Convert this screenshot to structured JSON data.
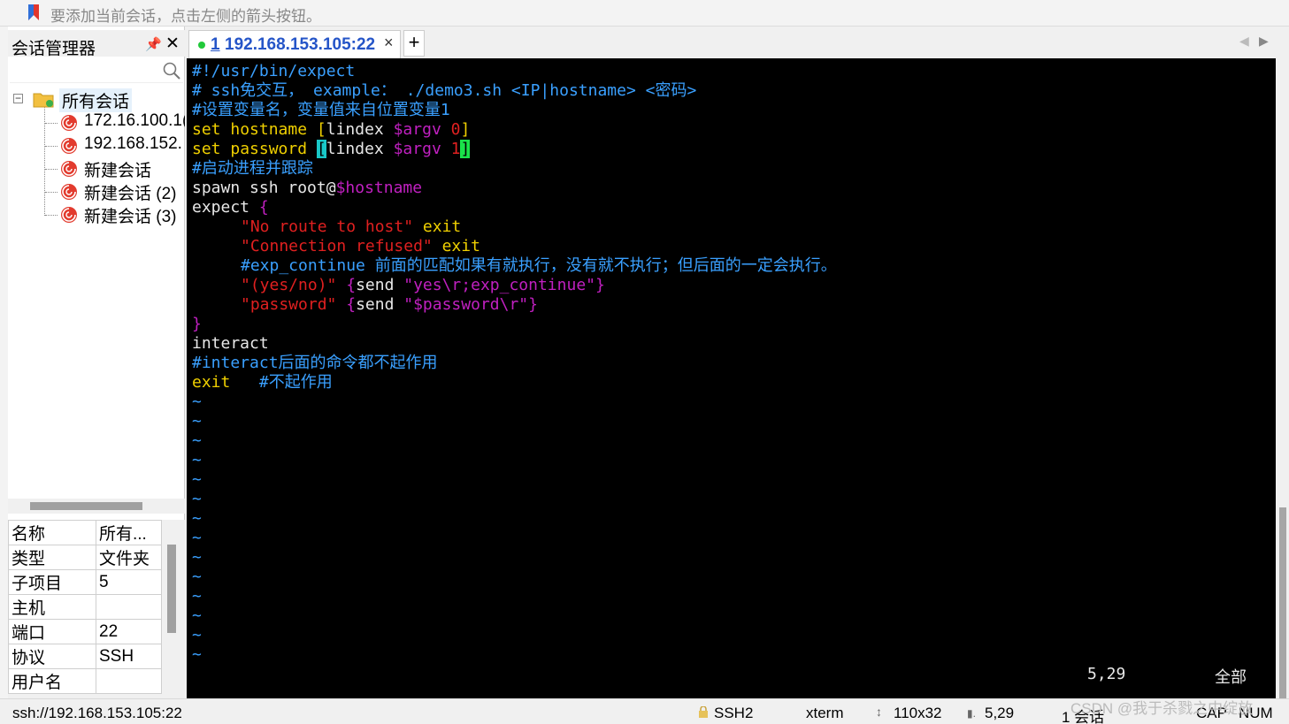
{
  "topbar": {
    "hint": "要添加当前会话，点击左侧的箭头按钮。"
  },
  "session_manager": {
    "title": "会话管理器",
    "pin_glyph": "📌",
    "close_glyph": "✕",
    "tree": {
      "root_label": "所有会话",
      "root_expander": "−",
      "items": [
        {
          "label": "172.16.100.1("
        },
        {
          "label": "192.168.152."
        },
        {
          "label": "新建会话"
        },
        {
          "label": "新建会话 (2)"
        },
        {
          "label": "新建会话 (3)"
        }
      ]
    },
    "properties": [
      {
        "key": "名称",
        "value": "所有..."
      },
      {
        "key": "类型",
        "value": "文件夹"
      },
      {
        "key": "子项目",
        "value": "5"
      },
      {
        "key": "主机",
        "value": ""
      },
      {
        "key": "端口",
        "value": "22"
      },
      {
        "key": "协议",
        "value": "SSH"
      },
      {
        "key": "用户名",
        "value": ""
      }
    ]
  },
  "tabs": {
    "active": {
      "number": "1",
      "label": "192.168.153.105:22",
      "close": "×"
    },
    "new_tab": "+",
    "nav_left": "◀",
    "nav_right": "▶"
  },
  "terminal": {
    "lines": {
      "l1": "#!/usr/bin/expect",
      "l2": "# ssh免交互， example： ./demo3.sh <IP|hostname> <密码>",
      "l3": "#设置变量名，变量值来自位置变量1",
      "l4_kw": "set",
      "l4_var": " hostname ",
      "l4_b1": "[",
      "l4_cmd": "lindex ",
      "l4_arg": "$argv ",
      "l4_n": "0",
      "l4_b2": "]",
      "l5_kw": "set",
      "l5_var": " password ",
      "l5_b1": "[",
      "l5_cmd": "lindex ",
      "l5_arg": "$argv ",
      "l5_n": "1",
      "l5_b2": "]",
      "l6": "#启动进程并跟踪",
      "l7_a": "spawn ssh root@",
      "l7_b": "$hostname",
      "l8_a": "expect ",
      "l8_b": "{",
      "l9_a": "\"No route to host\"",
      "l9_b": " exit",
      "l10_a": "\"Connection refused\"",
      "l10_b": " exit",
      "l11": "#exp_continue 前面的匹配如果有就执行，没有就不执行；但后面的一定会执行。",
      "l12_a": "\"(yes/no)\"",
      "l12_b": " {",
      "l12_c": "send ",
      "l12_d": "\"yes\\r;exp_continue\"",
      "l12_e": "}",
      "l13_a": "\"password\"",
      "l13_b": " {",
      "l13_c": "send ",
      "l13_d": "\"$password\\r\"",
      "l13_e": "}",
      "l14": "}",
      "l15": "interact",
      "l16": "#interact后面的命令都不起作用",
      "l17_a": "exit",
      "l17_b": "   #不起作用"
    },
    "tilde": "~",
    "cursor_pos": "5,29",
    "scope": "全部"
  },
  "statusbar": {
    "connection": "ssh://192.168.153.105:22",
    "protocol": "SSH2",
    "terminal_type": "xterm",
    "size": "110x32",
    "position": "5,29",
    "sessions": "1 会话",
    "caps": "CAP",
    "num": "NUM"
  },
  "watermark": "CSDN @我于杀戮之中绽放",
  "colors": {
    "terminal_bg": "#000000",
    "comment": "#3aa0ff",
    "keyword": "#f0d000",
    "string": "#e02020",
    "variable": "#c020c0",
    "tab_text": "#2555c8",
    "active_dot": "#21c93a"
  }
}
